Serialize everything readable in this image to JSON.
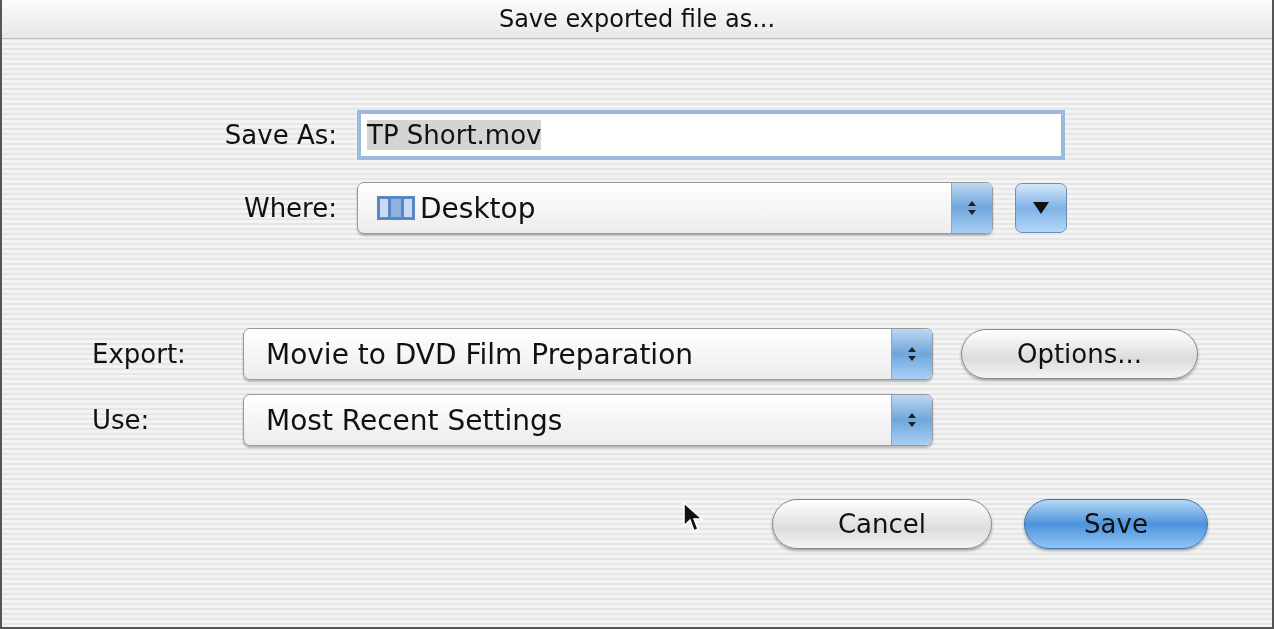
{
  "window": {
    "title": "Save exported file as..."
  },
  "save_as": {
    "label": "Save As:",
    "value": "TP Short.mov",
    "value_selected": true
  },
  "where": {
    "label": "Where:",
    "value": "Desktop",
    "expanded": false
  },
  "export": {
    "label": "Export:",
    "value": "Movie to DVD Film Preparation"
  },
  "use": {
    "label": "Use:",
    "value": "Most Recent Settings"
  },
  "options_button": "Options...",
  "buttons": [
    {
      "label": "Cancel",
      "default": false
    },
    {
      "label": "Save",
      "default": true
    }
  ]
}
